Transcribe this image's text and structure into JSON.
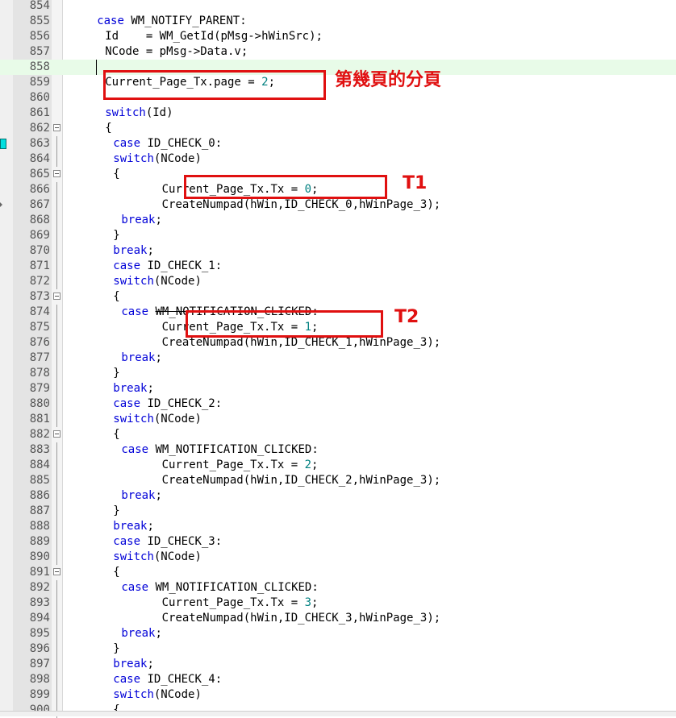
{
  "lines": [
    {
      "n": "854",
      "indent": 0,
      "tokens": []
    },
    {
      "n": "855",
      "indent": 4,
      "tokens": [
        {
          "t": "case",
          "c": "kw"
        },
        {
          "t": " WM_NOTIFY_PARENT:"
        }
      ]
    },
    {
      "n": "856",
      "indent": 5,
      "tokens": [
        {
          "t": "Id    = WM_GetId(pMsg->hWinSrc);"
        }
      ]
    },
    {
      "n": "857",
      "indent": 5,
      "tokens": [
        {
          "t": "NCode = pMsg->Data.v;"
        }
      ]
    },
    {
      "n": "858",
      "indent": 0,
      "tokens": [],
      "current": true,
      "caret": true
    },
    {
      "n": "859",
      "indent": 5,
      "tokens": [
        {
          "t": "Current_Page_Tx.page = "
        },
        {
          "t": "2",
          "c": "num"
        },
        {
          "t": ";"
        }
      ]
    },
    {
      "n": "860",
      "indent": 0,
      "tokens": []
    },
    {
      "n": "861",
      "indent": 5,
      "tokens": [
        {
          "t": "switch",
          "c": "kw"
        },
        {
          "t": "(Id)"
        }
      ]
    },
    {
      "n": "862",
      "indent": 5,
      "tokens": [
        {
          "t": "{"
        }
      ],
      "fold": "box"
    },
    {
      "n": "863",
      "indent": 6,
      "tokens": [
        {
          "t": "case",
          "c": "kw"
        },
        {
          "t": " ID_CHECK_0:"
        }
      ],
      "fold": "line",
      "marker": "cyan"
    },
    {
      "n": "864",
      "indent": 6,
      "tokens": [
        {
          "t": "switch",
          "c": "kw"
        },
        {
          "t": "(NCode)"
        }
      ],
      "fold": "line"
    },
    {
      "n": "865",
      "indent": 6,
      "tokens": [
        {
          "t": "{"
        }
      ],
      "fold": "box"
    },
    {
      "n": "866",
      "indent": 12,
      "tokens": [
        {
          "t": "Current_Page_Tx.Tx = "
        },
        {
          "t": "0",
          "c": "num"
        },
        {
          "t": ";"
        }
      ],
      "fold": "line"
    },
    {
      "n": "867",
      "indent": 12,
      "tokens": [
        {
          "t": "CreateNumpad(hWin,ID_CHECK_0,hWinPage_3);"
        }
      ],
      "fold": "line",
      "marker": "arrow"
    },
    {
      "n": "868",
      "indent": 7,
      "tokens": [
        {
          "t": "break",
          "c": "kw"
        },
        {
          "t": ";"
        }
      ],
      "fold": "line"
    },
    {
      "n": "869",
      "indent": 6,
      "tokens": [
        {
          "t": "}"
        }
      ],
      "fold": "line"
    },
    {
      "n": "870",
      "indent": 6,
      "tokens": [
        {
          "t": "break",
          "c": "kw"
        },
        {
          "t": ";"
        }
      ],
      "fold": "line"
    },
    {
      "n": "871",
      "indent": 6,
      "tokens": [
        {
          "t": "case",
          "c": "kw"
        },
        {
          "t": " ID_CHECK_1:"
        }
      ],
      "fold": "line"
    },
    {
      "n": "872",
      "indent": 6,
      "tokens": [
        {
          "t": "switch",
          "c": "kw"
        },
        {
          "t": "(NCode)"
        }
      ],
      "fold": "line"
    },
    {
      "n": "873",
      "indent": 6,
      "tokens": [
        {
          "t": "{"
        }
      ],
      "fold": "box"
    },
    {
      "n": "874",
      "indent": 7,
      "tokens": [
        {
          "t": "case",
          "c": "kw"
        },
        {
          "t": " "
        },
        {
          "t": "WM_NOTIFICATION_CLICKED:",
          "c": "strike"
        }
      ],
      "fold": "line"
    },
    {
      "n": "875",
      "indent": 12,
      "tokens": [
        {
          "t": "Current_Page_Tx.Tx = "
        },
        {
          "t": "1",
          "c": "num"
        },
        {
          "t": ";"
        }
      ],
      "fold": "line"
    },
    {
      "n": "876",
      "indent": 12,
      "tokens": [
        {
          "t": "CreateNumpad(hWin,ID_CHECK_1,hWinPage_3);"
        }
      ],
      "fold": "line"
    },
    {
      "n": "877",
      "indent": 7,
      "tokens": [
        {
          "t": "break",
          "c": "kw"
        },
        {
          "t": ";"
        }
      ],
      "fold": "line"
    },
    {
      "n": "878",
      "indent": 6,
      "tokens": [
        {
          "t": "}"
        }
      ],
      "fold": "line"
    },
    {
      "n": "879",
      "indent": 6,
      "tokens": [
        {
          "t": "break",
          "c": "kw"
        },
        {
          "t": ";"
        }
      ],
      "fold": "line"
    },
    {
      "n": "880",
      "indent": 6,
      "tokens": [
        {
          "t": "case",
          "c": "kw"
        },
        {
          "t": " ID_CHECK_2:"
        }
      ],
      "fold": "line"
    },
    {
      "n": "881",
      "indent": 6,
      "tokens": [
        {
          "t": "switch",
          "c": "kw"
        },
        {
          "t": "(NCode)"
        }
      ],
      "fold": "line"
    },
    {
      "n": "882",
      "indent": 6,
      "tokens": [
        {
          "t": "{"
        }
      ],
      "fold": "box"
    },
    {
      "n": "883",
      "indent": 7,
      "tokens": [
        {
          "t": "case",
          "c": "kw"
        },
        {
          "t": " WM_NOTIFICATION_CLICKED:"
        }
      ],
      "fold": "line"
    },
    {
      "n": "884",
      "indent": 12,
      "tokens": [
        {
          "t": "Current_Page_Tx.Tx = "
        },
        {
          "t": "2",
          "c": "num"
        },
        {
          "t": ";"
        }
      ],
      "fold": "line"
    },
    {
      "n": "885",
      "indent": 12,
      "tokens": [
        {
          "t": "CreateNumpad(hWin,ID_CHECK_2,hWinPage_3);"
        }
      ],
      "fold": "line"
    },
    {
      "n": "886",
      "indent": 7,
      "tokens": [
        {
          "t": "break",
          "c": "kw"
        },
        {
          "t": ";"
        }
      ],
      "fold": "line"
    },
    {
      "n": "887",
      "indent": 6,
      "tokens": [
        {
          "t": "}"
        }
      ],
      "fold": "line"
    },
    {
      "n": "888",
      "indent": 6,
      "tokens": [
        {
          "t": "break",
          "c": "kw"
        },
        {
          "t": ";"
        }
      ],
      "fold": "line"
    },
    {
      "n": "889",
      "indent": 6,
      "tokens": [
        {
          "t": "case",
          "c": "kw"
        },
        {
          "t": " ID_CHECK_3:"
        }
      ],
      "fold": "line"
    },
    {
      "n": "890",
      "indent": 6,
      "tokens": [
        {
          "t": "switch",
          "c": "kw"
        },
        {
          "t": "(NCode)"
        }
      ],
      "fold": "line"
    },
    {
      "n": "891",
      "indent": 6,
      "tokens": [
        {
          "t": "{"
        }
      ],
      "fold": "box"
    },
    {
      "n": "892",
      "indent": 7,
      "tokens": [
        {
          "t": "case",
          "c": "kw"
        },
        {
          "t": " WM_NOTIFICATION_CLICKED:"
        }
      ],
      "fold": "line"
    },
    {
      "n": "893",
      "indent": 12,
      "tokens": [
        {
          "t": "Current_Page_Tx.Tx = "
        },
        {
          "t": "3",
          "c": "num"
        },
        {
          "t": ";"
        }
      ],
      "fold": "line"
    },
    {
      "n": "894",
      "indent": 12,
      "tokens": [
        {
          "t": "CreateNumpad(hWin,ID_CHECK_3,hWinPage_3);"
        }
      ],
      "fold": "line"
    },
    {
      "n": "895",
      "indent": 7,
      "tokens": [
        {
          "t": "break",
          "c": "kw"
        },
        {
          "t": ";"
        }
      ],
      "fold": "line"
    },
    {
      "n": "896",
      "indent": 6,
      "tokens": [
        {
          "t": "}"
        }
      ],
      "fold": "line"
    },
    {
      "n": "897",
      "indent": 6,
      "tokens": [
        {
          "t": "break",
          "c": "kw"
        },
        {
          "t": ";"
        }
      ],
      "fold": "line"
    },
    {
      "n": "898",
      "indent": 6,
      "tokens": [
        {
          "t": "case",
          "c": "kw"
        },
        {
          "t": " ID_CHECK_4:"
        }
      ],
      "fold": "line"
    },
    {
      "n": "899",
      "indent": 6,
      "tokens": [
        {
          "t": "switch",
          "c": "kw"
        },
        {
          "t": "(NCode)"
        }
      ],
      "fold": "line"
    },
    {
      "n": "900",
      "indent": 6,
      "tokens": [
        {
          "t": "{"
        }
      ],
      "fold": "line"
    }
  ],
  "annotations": {
    "page_label": "第幾頁的分頁",
    "t1_label": "T1",
    "t2_label": "T2"
  },
  "colors": {
    "keyword": "#0000d8",
    "number": "#008080",
    "annotation_red": "#e01010",
    "current_line": "#e8fbe8",
    "bookmark_marker": "#00e0e0"
  }
}
